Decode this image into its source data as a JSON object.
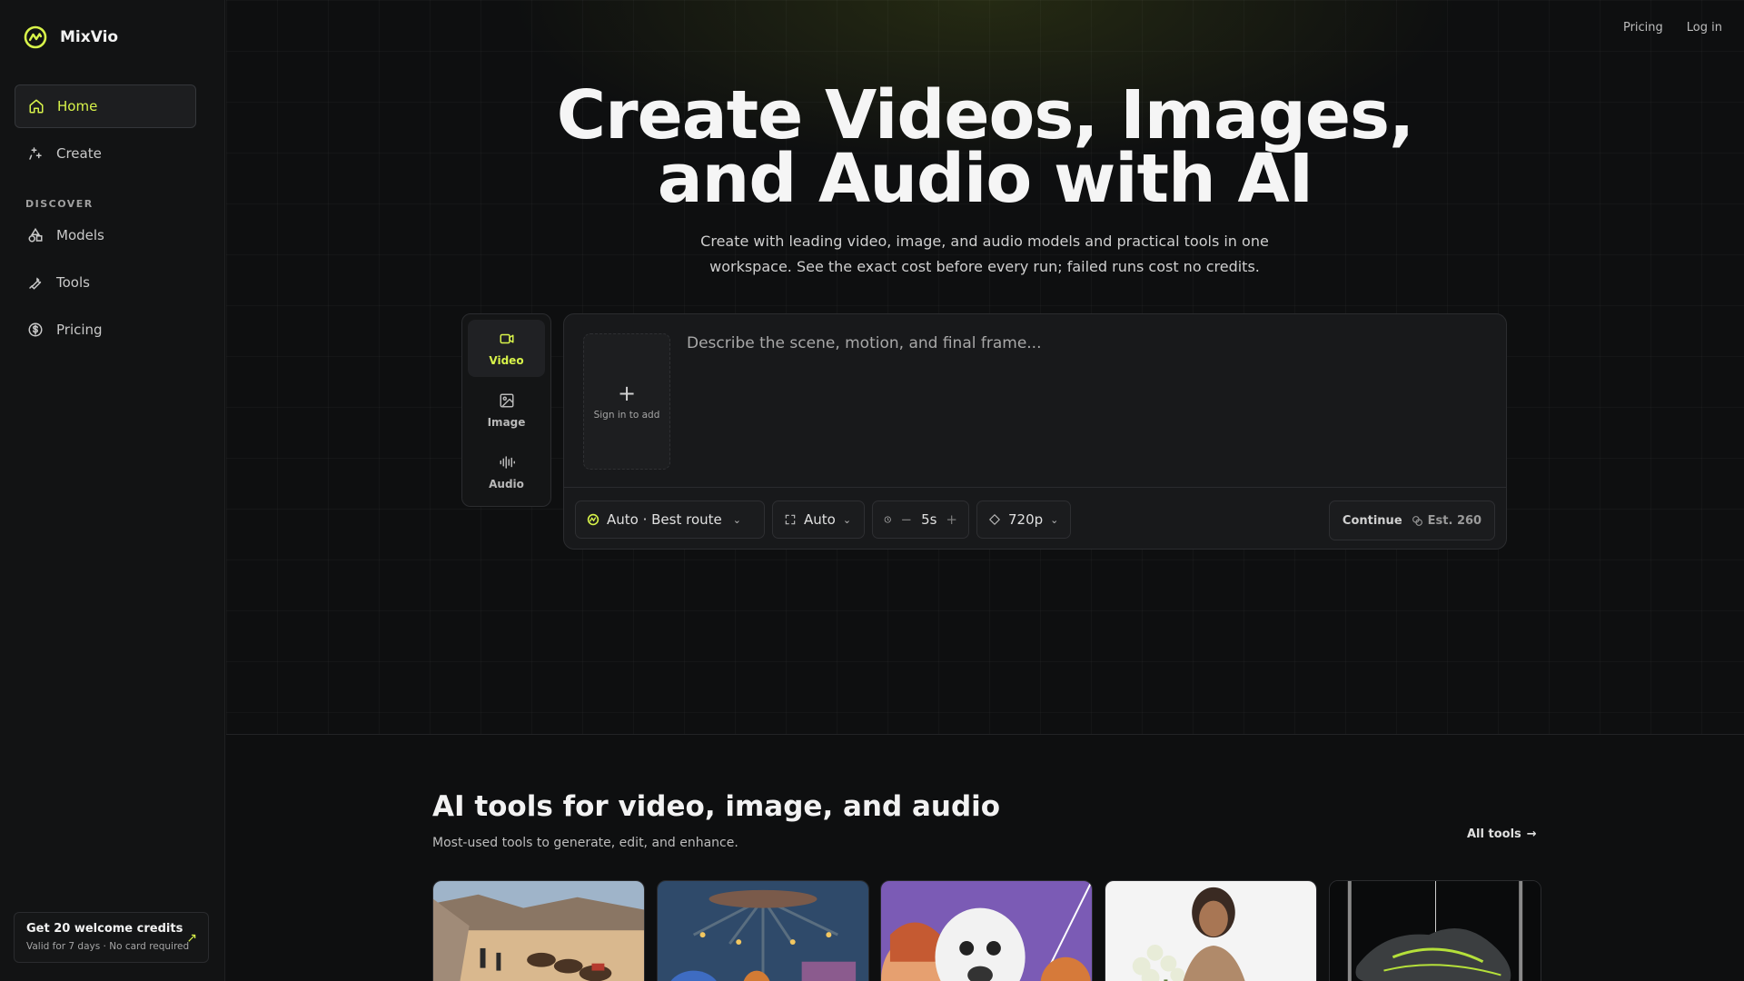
{
  "brand": {
    "name": "MixVio"
  },
  "sidebar": {
    "nav": [
      {
        "label": "Home",
        "icon": "home-icon",
        "active": true
      },
      {
        "label": "Create",
        "icon": "sparkle-icon"
      }
    ],
    "section_label": "DISCOVER",
    "discover": [
      {
        "label": "Models",
        "icon": "shapes-icon"
      },
      {
        "label": "Tools",
        "icon": "wrench-icon"
      },
      {
        "label": "Pricing",
        "icon": "dollar-circle-icon"
      }
    ],
    "credits": {
      "title": "Get 20 welcome credits",
      "subtitle": "Valid for 7 days · No card required",
      "icon": "arrow-up-right-icon"
    }
  },
  "topbar": {
    "pricing": "Pricing",
    "login": "Log in"
  },
  "hero": {
    "title_line1": "Create Videos, Images,",
    "title_line2": "and Audio with AI",
    "subtitle": "Create with leading video, image, and audio models and practical tools in one workspace. See the exact cost before every run; failed runs cost no credits."
  },
  "modes": [
    {
      "label": "Video",
      "icon": "video-icon",
      "active": true
    },
    {
      "label": "Image",
      "icon": "image-icon"
    },
    {
      "label": "Audio",
      "icon": "audio-wave-icon"
    }
  ],
  "composer": {
    "upload_label": "Sign in to add",
    "prompt_placeholder": "Describe the scene, motion, and final frame...",
    "model": "Auto · Best route",
    "aspect": "Auto",
    "duration": "5s",
    "resolution": "720p",
    "continue_label": "Continue",
    "estimate": "Est. 260"
  },
  "tools_section": {
    "title": "AI tools for video, image, and audio",
    "subtitle": "Most-used tools to generate, edit, and enhance.",
    "all_tools": "All tools",
    "cards": [
      {
        "name": "desert-caravan-thumbnail"
      },
      {
        "name": "carnival-characters-thumbnail"
      },
      {
        "name": "cartoon-bear-thumbnail"
      },
      {
        "name": "woman-flowers-thumbnail"
      },
      {
        "name": "sneaker-thumbnail"
      }
    ]
  },
  "colors": {
    "accent": "#d8f34a",
    "background": "#0e0f10",
    "sidebar": "#121314"
  }
}
